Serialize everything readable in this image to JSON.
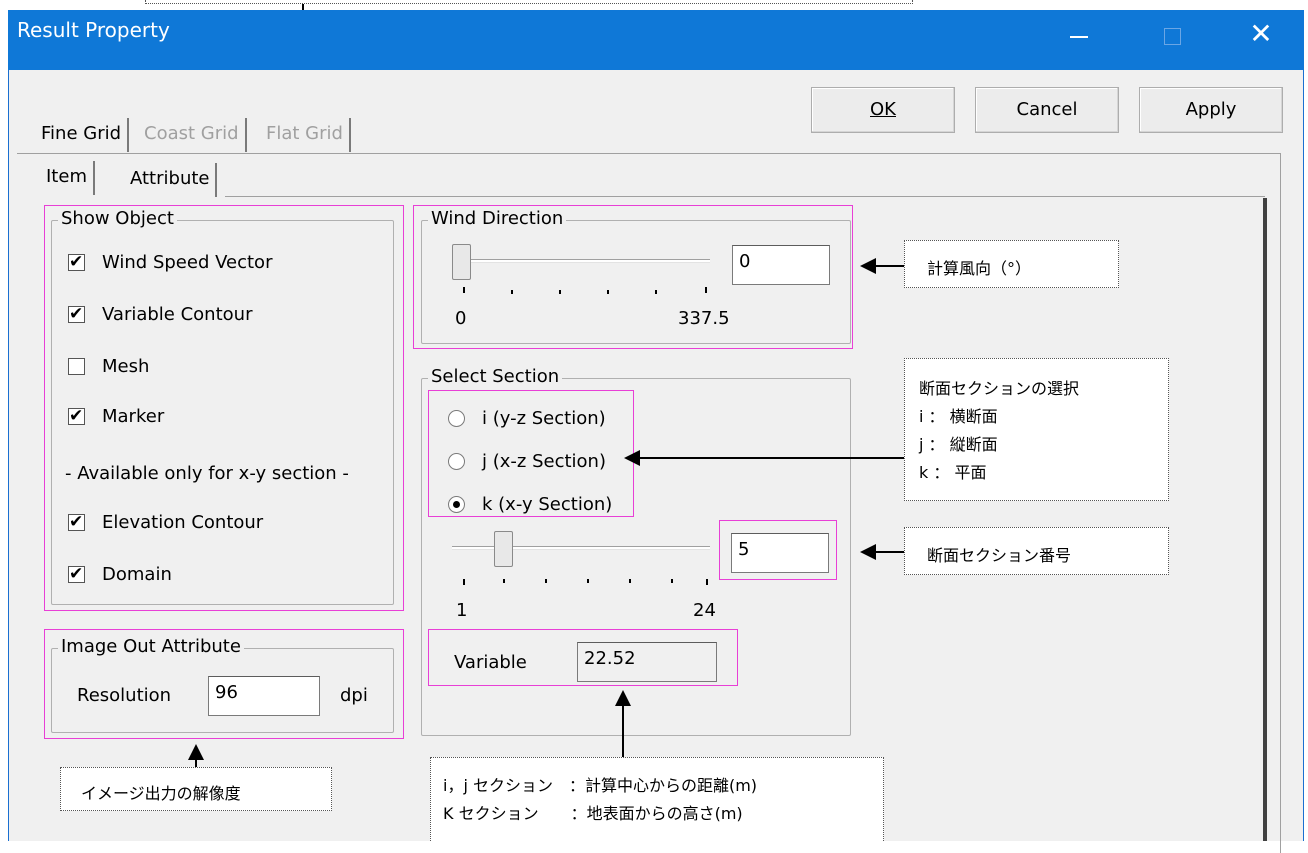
{
  "window": {
    "title": "Result Property",
    "minimize_icon": "minimize-icon",
    "maximize_icon": "maximize-icon",
    "close_icon": "close-icon",
    "close_glyph": "✕"
  },
  "buttons": {
    "ok": "OK",
    "cancel": "Cancel",
    "apply": "Apply"
  },
  "grid_tabs": [
    "Fine Grid",
    "Coast Grid",
    "Flat Grid"
  ],
  "sub_tabs": [
    "Item",
    "Attribute"
  ],
  "show_object": {
    "legend": "Show Object",
    "items": [
      {
        "label": "Wind Speed Vector",
        "checked": true
      },
      {
        "label": "Variable Contour",
        "checked": true
      },
      {
        "label": "Mesh",
        "checked": false
      },
      {
        "label": "Marker",
        "checked": true
      }
    ],
    "note": "- Available only for x-y section -",
    "xy_items": [
      {
        "label": "Elevation Contour",
        "checked": true
      },
      {
        "label": "Domain",
        "checked": true
      }
    ]
  },
  "image_out": {
    "legend": "Image Out Attribute",
    "resolution_label": "Resolution",
    "resolution_value": "96",
    "unit": "dpi"
  },
  "wind_direction": {
    "legend": "Wind Direction",
    "value": "0",
    "min_label": "0",
    "max_label": "337.5"
  },
  "select_section": {
    "legend": "Select Section",
    "options": [
      {
        "label": "i (y-z Section)",
        "selected": false
      },
      {
        "label": "j (x-z Section)",
        "selected": false
      },
      {
        "label": "k (x-y Section)",
        "selected": true
      }
    ],
    "section_value": "5",
    "min_label": "1",
    "max_label": "24",
    "variable_label": "Variable",
    "variable_value": "22.52"
  },
  "callouts": {
    "wind_direction": "計算風向（°）",
    "section_select_title": "断面セクションの選択",
    "section_select_i": "i ： 横断面",
    "section_select_j": "j ： 縦断面",
    "section_select_k": "k ： 平面",
    "section_number": "断面セクション番号",
    "image_resolution": "イメージ出力の解像度",
    "variable_line1": "i，j セクション　：計算中心からの距離(m)",
    "variable_line2": "K セクション　　：地表面からの高さ(m)"
  },
  "colors": {
    "titlebar": "#0f78d7",
    "highlight_box": "#e83fd6",
    "dialog_bg": "#f0f0f0"
  }
}
